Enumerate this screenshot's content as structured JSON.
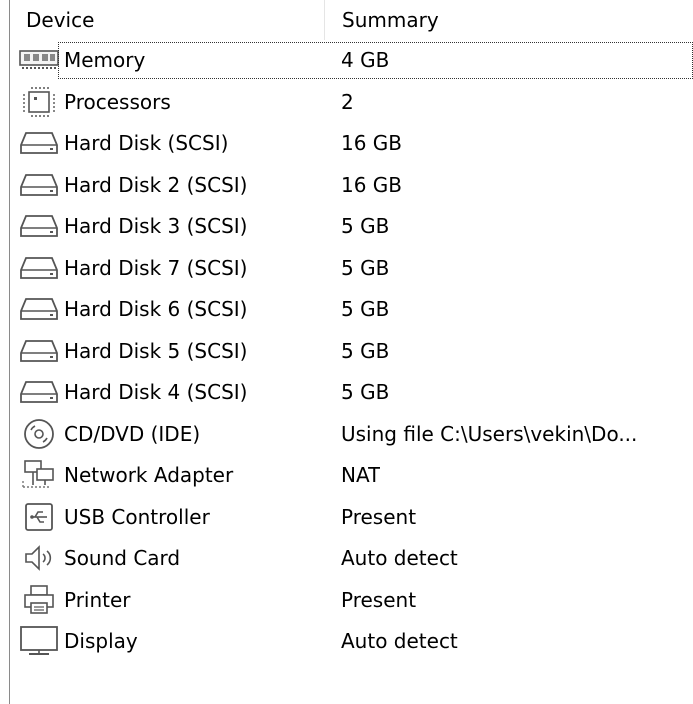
{
  "columns": {
    "device": "Device",
    "summary": "Summary"
  },
  "rows": [
    {
      "icon": "memory-icon",
      "device": "Memory",
      "summary": "4 GB"
    },
    {
      "icon": "processor-icon",
      "device": "Processors",
      "summary": "2"
    },
    {
      "icon": "hard-disk-icon",
      "device": "Hard Disk (SCSI)",
      "summary": "16 GB"
    },
    {
      "icon": "hard-disk-icon",
      "device": "Hard Disk 2 (SCSI)",
      "summary": "16 GB"
    },
    {
      "icon": "hard-disk-icon",
      "device": "Hard Disk 3 (SCSI)",
      "summary": "5 GB"
    },
    {
      "icon": "hard-disk-icon",
      "device": "Hard Disk 7 (SCSI)",
      "summary": "5 GB"
    },
    {
      "icon": "hard-disk-icon",
      "device": "Hard Disk 6 (SCSI)",
      "summary": "5 GB"
    },
    {
      "icon": "hard-disk-icon",
      "device": "Hard Disk 5 (SCSI)",
      "summary": "5 GB"
    },
    {
      "icon": "hard-disk-icon",
      "device": "Hard Disk 4 (SCSI)",
      "summary": "5 GB"
    },
    {
      "icon": "cd-dvd-icon",
      "device": "CD/DVD (IDE)",
      "summary": "Using file C:\\Users\\vekin\\Do..."
    },
    {
      "icon": "network-adapter-icon",
      "device": "Network Adapter",
      "summary": "NAT"
    },
    {
      "icon": "usb-icon",
      "device": "USB Controller",
      "summary": "Present"
    },
    {
      "icon": "sound-icon",
      "device": "Sound Card",
      "summary": "Auto detect"
    },
    {
      "icon": "printer-icon",
      "device": "Printer",
      "summary": "Present"
    },
    {
      "icon": "display-icon",
      "device": "Display",
      "summary": "Auto detect"
    }
  ]
}
